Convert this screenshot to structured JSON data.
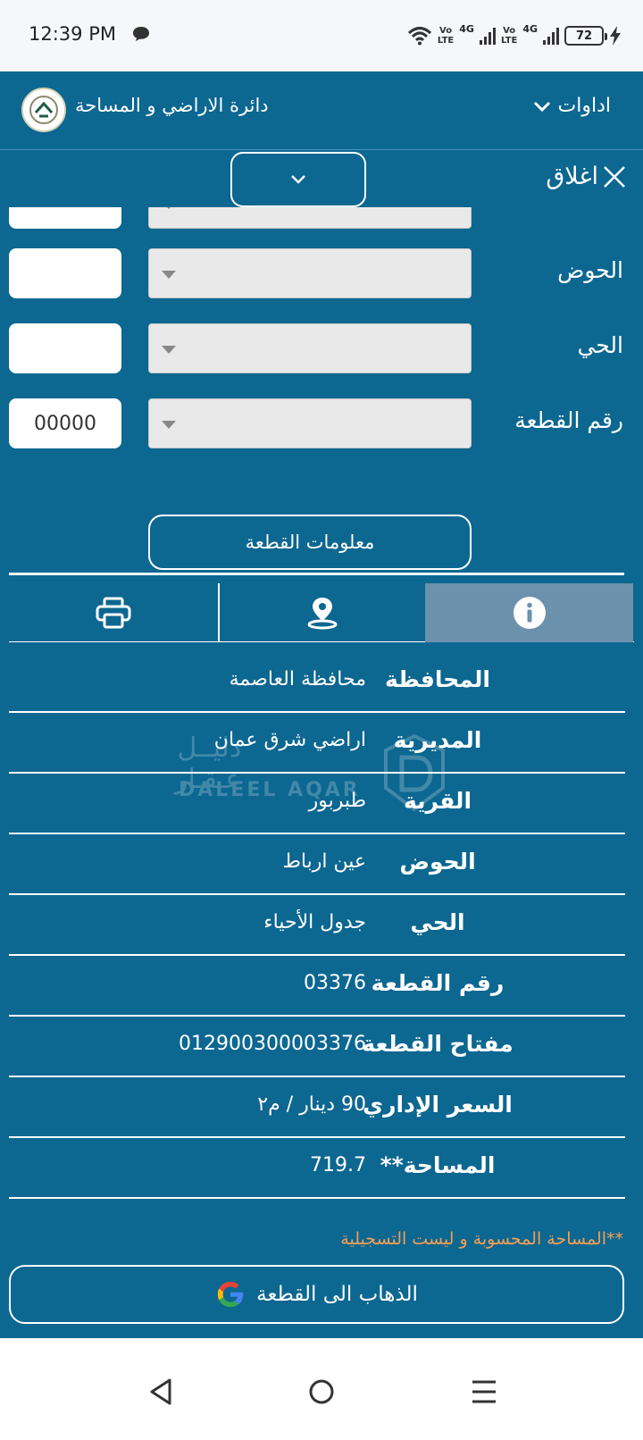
{
  "status_bar": {
    "time": "12:39 PM",
    "net1": "Vo\nLTE",
    "g1": "4G",
    "net2": "Vo\nLTE",
    "g2": "4G",
    "battery": "72"
  },
  "header": {
    "site_title": "دائرة الاراضي و المساحة",
    "tools_label": "اداوات"
  },
  "panel": {
    "close_label": "اغلاق"
  },
  "form": {
    "rows": [
      {
        "label": "الحوض",
        "value": ""
      },
      {
        "label": "الحي",
        "value": ""
      },
      {
        "label": "رقم القطعة",
        "value": "00000"
      }
    ],
    "info_button": "معلومات القطعة"
  },
  "details": [
    {
      "key": "المحافظة",
      "value": "محافظة العاصمة"
    },
    {
      "key": "المديرية",
      "value": "اراضي شرق عمان"
    },
    {
      "key": "القرية",
      "value": "طبربور"
    },
    {
      "key": "الحوض",
      "value": "عين ارباط"
    },
    {
      "key": "الحي",
      "value": "جدول الأحياء"
    },
    {
      "key": "رقم القطعة",
      "value": "03376"
    },
    {
      "key": "مفتاح القطعة",
      "value": "012900300003376"
    },
    {
      "key": "السعر الإداري",
      "value": "90 دينار / م٢"
    },
    {
      "key": "المساحة**",
      "value": "719.7"
    }
  ],
  "note": "**المساحة المحسوبة و ليست التسجيلية",
  "go_button": "الذهاب الى القطعة",
  "watermark": {
    "ar": "دليــل عـقـار",
    "en": "DALEEL AQAR"
  },
  "colors": {
    "primary": "#0c6791",
    "tab_active": "#6c91ac",
    "note": "#f39f55"
  }
}
